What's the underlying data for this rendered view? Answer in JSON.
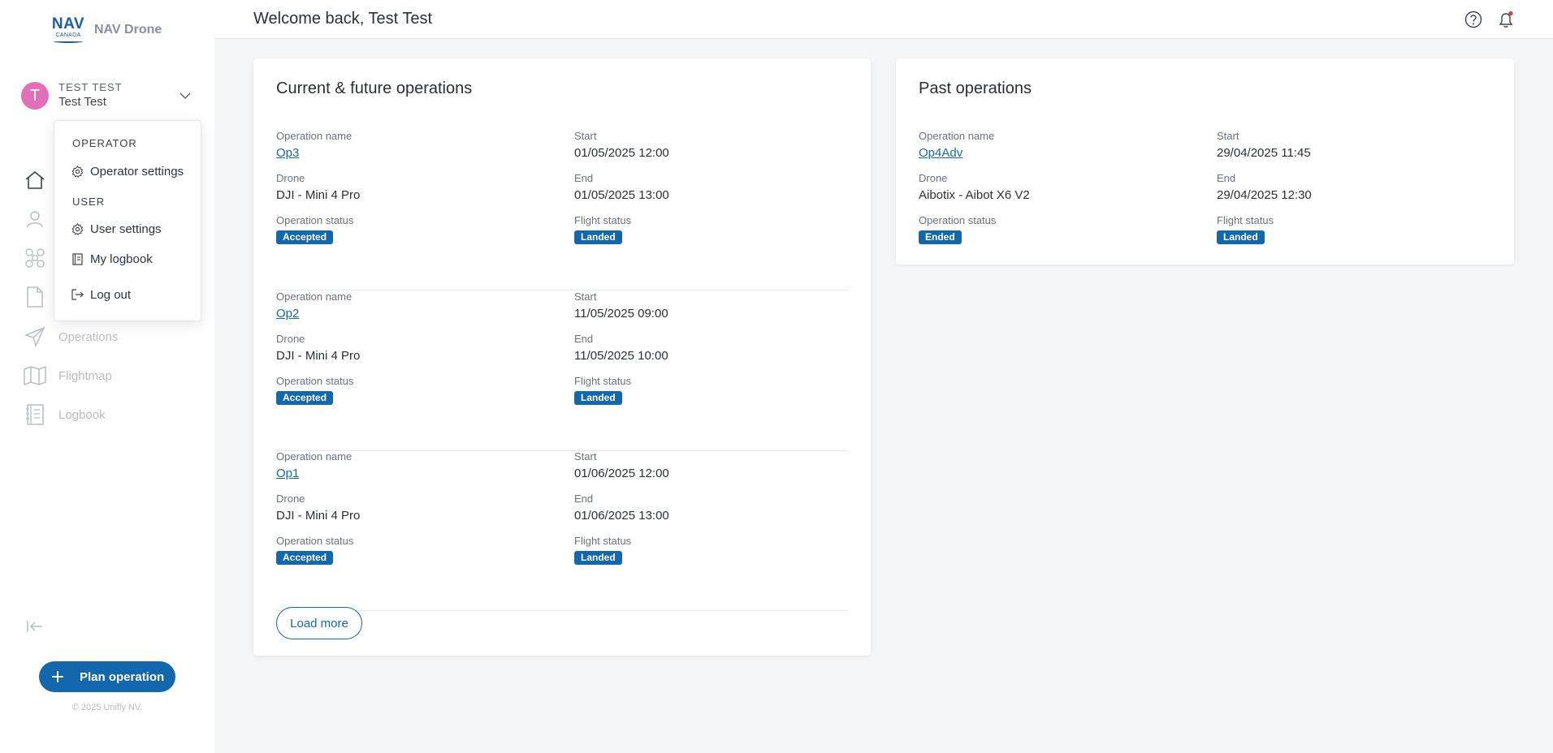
{
  "brand": {
    "logo_main": "NAV",
    "logo_sub": "CANADA",
    "name": "NAV Drone"
  },
  "user": {
    "initial": "T",
    "upper": "TEST TEST",
    "name": "Test Test"
  },
  "dropdown": {
    "operator_section": "OPERATOR",
    "operator_settings": "Operator settings",
    "user_section": "USER",
    "user_settings": "User settings",
    "my_logbook": "My logbook",
    "log_out": "Log out"
  },
  "nav": {
    "operations": "Operations",
    "flightmap": "Flightmap",
    "logbook": "Logbook"
  },
  "sidebar": {
    "plan_button": "Plan operation",
    "copyright": "© 2025 Unifly NV."
  },
  "header": {
    "welcome": "Welcome back, Test Test"
  },
  "labels": {
    "operation_name": "Operation name",
    "start": "Start",
    "drone": "Drone",
    "end": "End",
    "operation_status": "Operation status",
    "flight_status": "Flight status"
  },
  "current": {
    "title": "Current & future operations",
    "load_more": "Load more",
    "ops": [
      {
        "name": "Op3",
        "start": "01/05/2025 12:00",
        "drone": "DJI - Mini 4 Pro",
        "end": "01/05/2025 13:00",
        "op_status": "Accepted",
        "flight_status": "Landed"
      },
      {
        "name": "Op2",
        "start": "11/05/2025 09:00",
        "drone": "DJI - Mini 4 Pro",
        "end": "11/05/2025 10:00",
        "op_status": "Accepted",
        "flight_status": "Landed"
      },
      {
        "name": "Op1",
        "start": "01/06/2025 12:00",
        "drone": "DJI - Mini 4 Pro",
        "end": "01/06/2025 13:00",
        "op_status": "Accepted",
        "flight_status": "Landed"
      }
    ]
  },
  "past": {
    "title": "Past operations",
    "ops": [
      {
        "name": "Op4Adv",
        "start": "29/04/2025 11:45",
        "drone": "Aibotix - Aibot X6 V2",
        "end": "29/04/2025 12:30",
        "op_status": "Ended",
        "flight_status": "Landed"
      }
    ]
  },
  "colors": {
    "primary": "#1267ad",
    "avatar": "#e36fb8",
    "notification_dot": "#e03a3a"
  }
}
